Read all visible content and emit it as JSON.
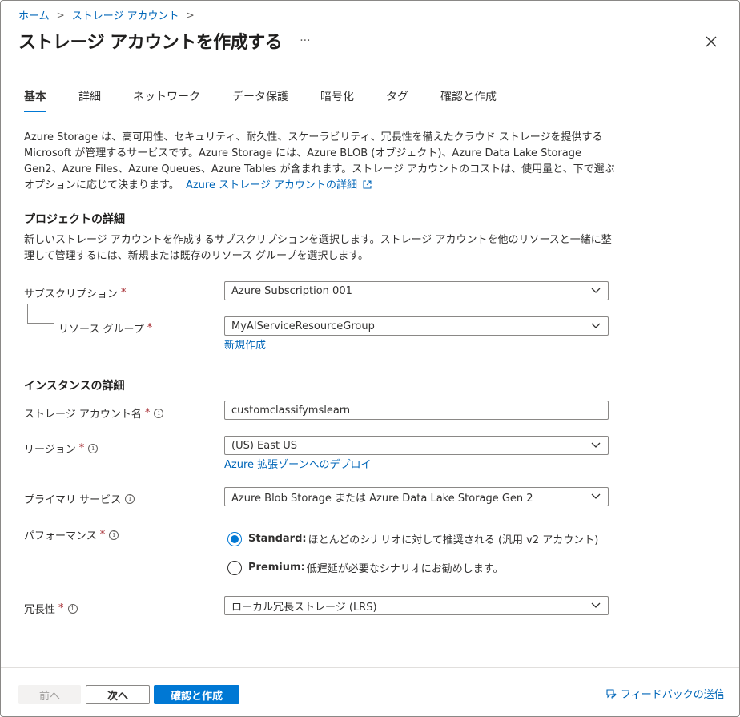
{
  "breadcrumb": {
    "home": "ホーム",
    "storage_accounts": "ストレージ アカウント"
  },
  "page": {
    "title": "ストレージ アカウントを作成する",
    "more": "···"
  },
  "tabs": [
    {
      "label": "基本"
    },
    {
      "label": "詳細"
    },
    {
      "label": "ネットワーク"
    },
    {
      "label": "データ保護"
    },
    {
      "label": "暗号化"
    },
    {
      "label": "タグ"
    },
    {
      "label": "確認と作成"
    }
  ],
  "intro": {
    "text": "Azure Storage は、高可用性、セキュリティ、耐久性、スケーラビリティ、冗長性を備えたクラウド ストレージを提供する Microsoft が管理するサービスです。Azure Storage には、Azure BLOB (オブジェクト)、Azure Data Lake Storage Gen2、Azure Files、Azure Queues、Azure Tables が含まれます。ストレージ アカウントのコストは、使用量と、下で選ぶオプションに応じて決まります。",
    "link": "Azure ストレージ アカウントの詳細"
  },
  "project": {
    "heading": "プロジェクトの詳細",
    "description": "新しいストレージ アカウントを作成するサブスクリプションを選択します。ストレージ アカウントを他のリソースと一緒に整理して管理するには、新規または既存のリソース グループを選択します。",
    "subscription_label": "サブスクリプション",
    "subscription_value": "Azure Subscription 001",
    "resource_group_label": "リソース グループ",
    "resource_group_value": "MyAIServiceResourceGroup",
    "create_new_link": "新規作成"
  },
  "instance": {
    "heading": "インスタンスの詳細",
    "account_name_label": "ストレージ アカウント名",
    "account_name_value": "customclassifymslearn",
    "region_label": "リージョン",
    "region_value": "(US) East US",
    "edge_zone_link": "Azure 拡張ゾーンへのデプロイ",
    "primary_service_label": "プライマリ サービス",
    "primary_service_value": "Azure Blob Storage または Azure Data Lake Storage Gen 2",
    "performance_label": "パフォーマンス",
    "performance_options": [
      {
        "name": "Standard:",
        "desc": "ほとんどのシナリオに対して推奨される (汎用 v2 アカウント)",
        "selected": true
      },
      {
        "name": "Premium:",
        "desc": "低遅延が必要なシナリオにお勧めします。",
        "selected": false
      }
    ],
    "redundancy_label": "冗長性",
    "redundancy_value": "ローカル冗長ストレージ (LRS)"
  },
  "required_mark": "*",
  "info_mark": "i",
  "footer": {
    "prev": "前へ",
    "next": "次へ",
    "review_create": "確認と作成",
    "feedback": "フィードバックの送信"
  },
  "colors": {
    "accent": "#0078d4",
    "link": "#0066b8",
    "required": "#a4262c"
  }
}
